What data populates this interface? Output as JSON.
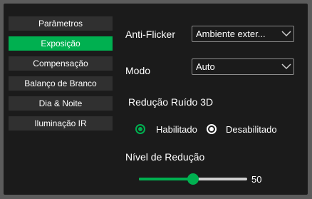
{
  "sidebar": {
    "items": [
      {
        "label": "Parâmetros",
        "active": false
      },
      {
        "label": "Exposição",
        "active": true
      },
      {
        "label": "Compensação",
        "active": false
      },
      {
        "label": "Balanço de Branco",
        "active": false
      },
      {
        "label": "Dia & Noite",
        "active": false
      },
      {
        "label": "Iluminação IR",
        "active": false
      }
    ]
  },
  "anti_flicker": {
    "label": "Anti-Flicker",
    "value": "Ambiente exter..."
  },
  "mode": {
    "label": "Modo",
    "value": "Auto"
  },
  "noise_reduction": {
    "title": "Redução Ruído 3D",
    "options": [
      {
        "label": "Habilitado",
        "selected": true
      },
      {
        "label": "Desabilitado",
        "selected": false
      }
    ]
  },
  "reduction_level": {
    "label": "Nível de Redução",
    "value": 50,
    "min": 0,
    "max": 100
  },
  "colors": {
    "accent": "#00b050",
    "panel": "#1b1b1b",
    "menu_item": "#303030"
  }
}
